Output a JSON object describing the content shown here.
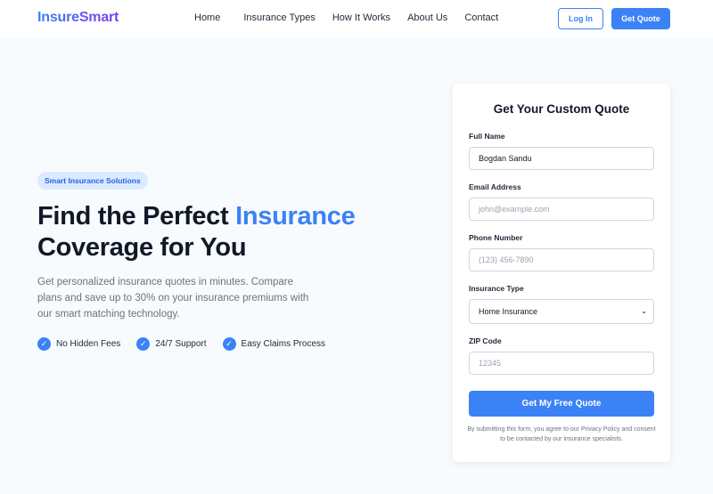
{
  "header": {
    "logo": "InsureSmart",
    "nav": [
      "Home",
      "Insurance Types",
      "How It Works",
      "About Us",
      "Contact"
    ],
    "login_label": "Log In",
    "quote_label": "Get Quote"
  },
  "hero": {
    "badge": "Smart Insurance Solutions",
    "title_part1": "Find the Perfect ",
    "title_accent": "Insurance",
    "title_part2": "Coverage for You",
    "description": "Get personalized insurance quotes in minutes. Compare plans and save up to 30% on your insurance premiums with our smart matching technology.",
    "features": [
      "No Hidden Fees",
      "24/7 Support",
      "Easy Claims Process"
    ]
  },
  "form": {
    "title": "Get Your Custom Quote",
    "full_name": {
      "label": "Full Name",
      "value": "Bogdan Sandu"
    },
    "email": {
      "label": "Email Address",
      "placeholder": "john@example.com"
    },
    "phone": {
      "label": "Phone Number",
      "placeholder": "(123) 456-7890"
    },
    "insurance_type": {
      "label": "Insurance Type",
      "selected": "Home Insurance"
    },
    "zip": {
      "label": "ZIP Code",
      "placeholder": "12345"
    },
    "submit_label": "Get My Free Quote",
    "disclaimer": "By submitting this form, you agree to our Privacy Policy and consent to be contacted by our insurance specialists."
  },
  "colors": {
    "accent": "#3b82f6",
    "logo_gradient_end": "#7c3aed",
    "background": "#f8fbfd"
  },
  "icons": {
    "feature_check": "check-circle-icon",
    "select_caret": "chevron-down-icon"
  }
}
